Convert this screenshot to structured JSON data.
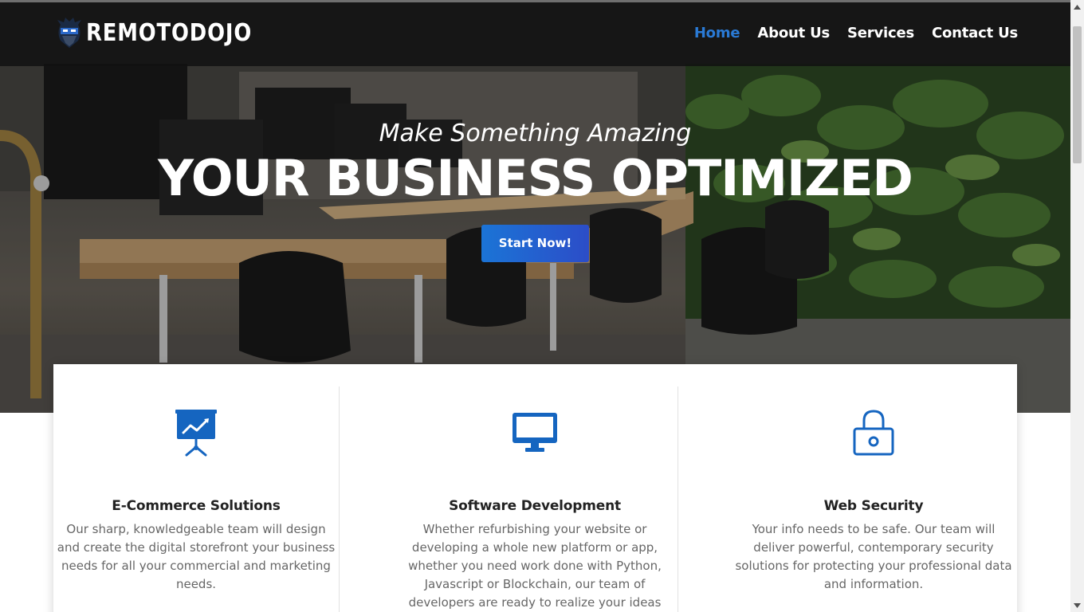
{
  "nav": {
    "logo_text": "REMOTODOJO",
    "items": [
      {
        "label": "Home",
        "active": true
      },
      {
        "label": "About Us",
        "active": false
      },
      {
        "label": "Services",
        "active": false
      },
      {
        "label": "Contact Us",
        "active": false
      }
    ]
  },
  "hero": {
    "tagline": "Make Something Amazing",
    "headline": "YOUR BUSINESS OPTIMIZED",
    "cta_label": "Start Now!"
  },
  "services": [
    {
      "icon": "presentation-chart-icon",
      "title": "E-Commerce Solutions",
      "description": "Our sharp, knowledgeable team will design and create the digital storefront your business needs for all your commercial and marketing needs."
    },
    {
      "icon": "monitor-icon",
      "title": "Software Development",
      "description": "Whether refurbishing your website or developing a whole new platform or app, whether you need work done with Python, Javascript or Blockchain, our team of developers are ready to realize your ideas"
    },
    {
      "icon": "lock-icon",
      "title": "Web Security",
      "description": "Your info needs to be safe. Our team will deliver powerful, contemporary security solutions for protecting your professional data and information."
    }
  ],
  "colors": {
    "accent": "#2a7ad5",
    "icon_blue": "#1565c0",
    "nav_bg": "#111111",
    "cta_start": "#1b74d6",
    "cta_end": "#2c4dc8"
  }
}
